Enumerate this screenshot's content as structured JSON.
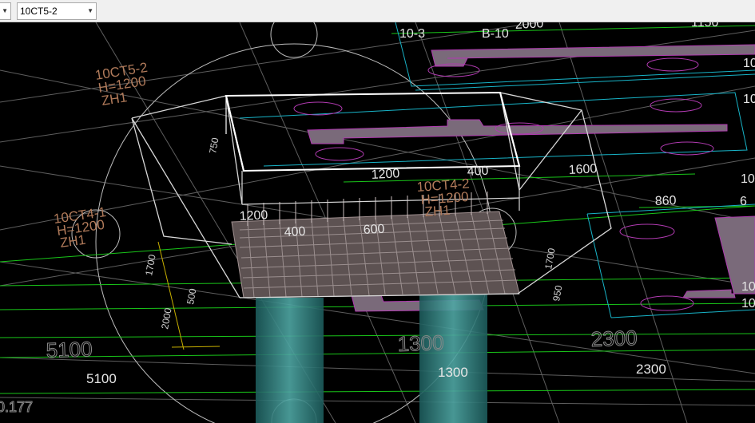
{
  "toolbar": {
    "layer_dropdown_value": "",
    "element_dropdown_value": "10CT5-2"
  },
  "colors": {
    "background": "#000000",
    "grid_gray": "#6b6b6b",
    "dim_green": "#19c519",
    "cyan": "#18b4c8",
    "magenta": "#b03ab0",
    "label_brown": "#b07a5a",
    "wire_white": "#ffffff"
  },
  "labels": {
    "top_left_a": "10-3",
    "top_left_b": "B-10",
    "top_dim_2000": "2000",
    "top_dim_1150": "1150",
    "cap_a_name": "10CT5-2",
    "cap_a_h": "H=1200",
    "cap_a_zh": "ZH1",
    "cap_b_name": "10CT4-2",
    "cap_b_h": "H=1200",
    "cap_b_zh": "ZH1",
    "cap_c_name": "10CT4-1",
    "cap_c_h": "H=1200",
    "cap_c_zh": "ZH1",
    "dim_1200": "1200",
    "dim_400": "400",
    "dim_1600": "1600",
    "dim_860": "860",
    "dim_1200b": "1200",
    "dim_5100_ground": "5100",
    "dim_1300_ground": "1300",
    "dim_2300_ground": "2300",
    "dim_5100": "5100",
    "dim_1300": "1300",
    "dim_2300": "2300",
    "dim_177": "0.177",
    "right_10a": "10",
    "right_10b": "10",
    "right_10c": "10",
    "right_10d": "10",
    "right_10e": "10",
    "right_6": "6",
    "side_750": "750",
    "side_1700": "1700",
    "side_1700b": "1700",
    "side_2000": "2000",
    "side_500": "500",
    "side_950": "950",
    "dim_400b": "400",
    "dim_600": "600"
  }
}
